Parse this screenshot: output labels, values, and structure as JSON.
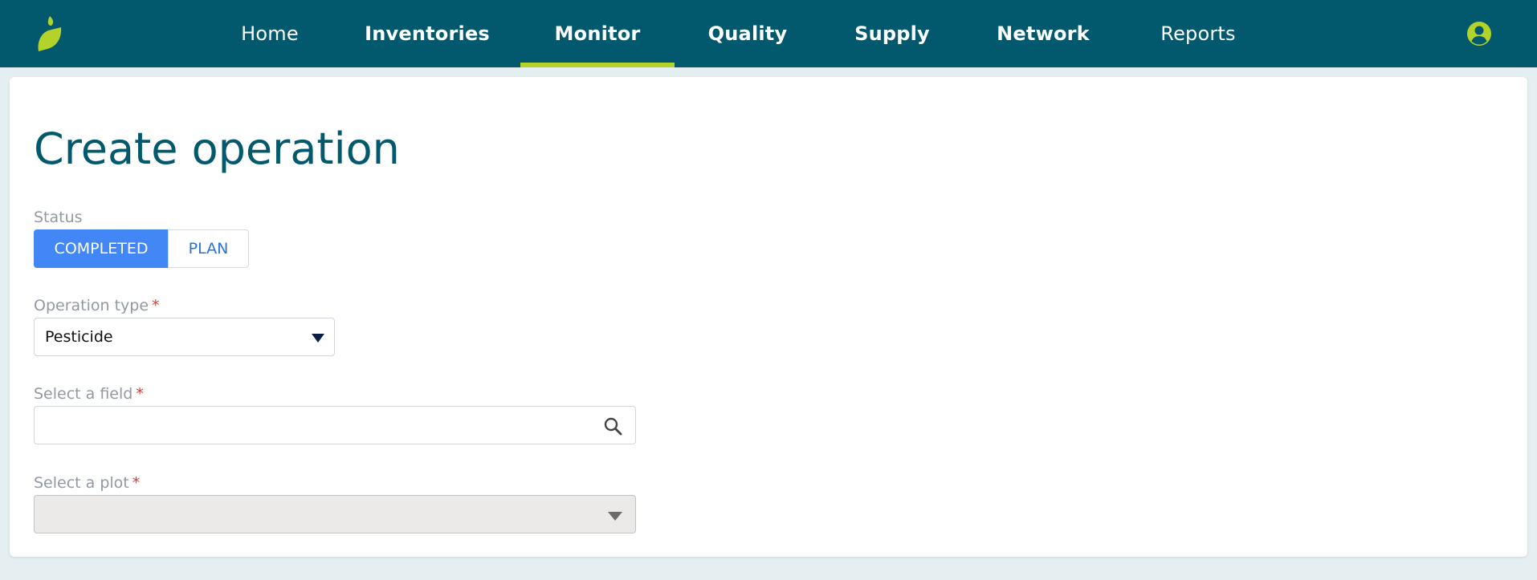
{
  "app": {
    "brand_color": "#02596e",
    "accent_color": "#b3d32b",
    "logo_icon": "leaf-logo-icon",
    "avatar_icon": "user-circle-icon"
  },
  "nav": {
    "items": [
      {
        "label": "Home",
        "active": false
      },
      {
        "label": "Inventories",
        "active": false
      },
      {
        "label": "Monitor",
        "active": true
      },
      {
        "label": "Quality",
        "active": false
      },
      {
        "label": "Supply",
        "active": false
      },
      {
        "label": "Network",
        "active": false
      },
      {
        "label": "Reports",
        "active": false
      }
    ]
  },
  "page": {
    "title": "Create operation"
  },
  "form": {
    "status": {
      "label": "Status",
      "options": [
        "COMPLETED",
        "PLAN"
      ],
      "selected": "COMPLETED",
      "selected_color": "#4287f5"
    },
    "operation_type": {
      "label": "Operation type",
      "required_mark": "*",
      "value": "Pesticide"
    },
    "field": {
      "label": "Select a field",
      "required_mark": "*",
      "value": "",
      "icon": "search-icon"
    },
    "plot": {
      "label": "Select a plot",
      "required_mark": "*",
      "value": "",
      "disabled": true
    }
  }
}
